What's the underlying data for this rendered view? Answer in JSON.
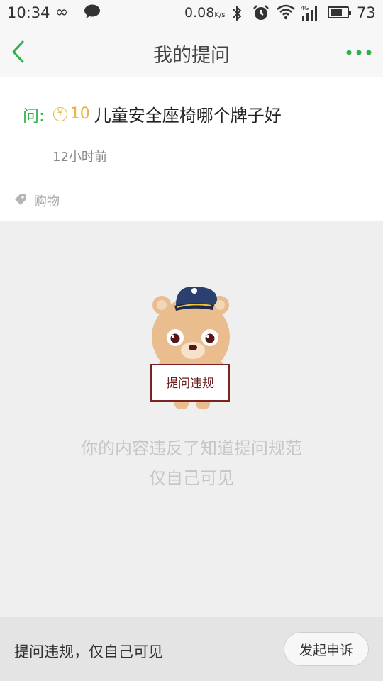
{
  "status_bar": {
    "time": "10:34",
    "net_speed_value": "0.08",
    "net_speed_unit": "K/s",
    "network_type": "4G",
    "battery_percent": "73",
    "battery_level": 0.73,
    "icons": [
      "infinity-icon",
      "chat-bubble-icon",
      "bluetooth-icon",
      "alarm-icon",
      "wifi-icon",
      "signal-icon",
      "battery-icon"
    ]
  },
  "nav": {
    "title": "我的提问",
    "back_icon": "chevron-left-icon",
    "more_icon": "more-dots-icon"
  },
  "question": {
    "prefix": "问:",
    "reward": "10",
    "coin_symbol": "¥",
    "text": "儿童安全座椅哪个牌子好",
    "time": "12小时前",
    "tag": "购物"
  },
  "violation": {
    "sign": "提问违规",
    "line1": "你的内容违反了知道提问规范",
    "line2": "仅自己可见"
  },
  "bottom": {
    "text": "提问违规，仅自己可见",
    "appeal_label": "发起申诉"
  },
  "colors": {
    "accent_green": "#2db14a",
    "coin_gold": "#e8b742",
    "sign_red": "#6b1e1e"
  }
}
